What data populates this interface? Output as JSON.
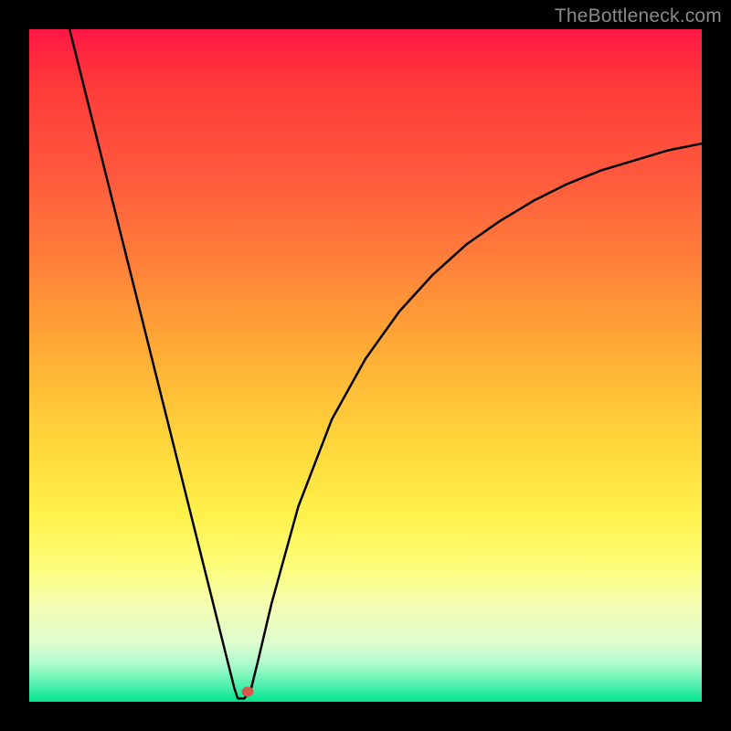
{
  "watermark": "TheBottleneck.com",
  "marker": {
    "x_frac": 0.325,
    "y_frac": 0.985
  },
  "colors": {
    "top": "#ff1744",
    "bottom": "#00e58c",
    "frame": "#000000",
    "curve": "#000000",
    "marker": "#d6574c",
    "watermark": "#8a8a8a"
  },
  "chart_data": {
    "type": "line",
    "title": "",
    "xlabel": "",
    "ylabel": "",
    "xlim": [
      0,
      1
    ],
    "ylim": [
      0,
      1
    ],
    "background_gradient": {
      "direction": "vertical",
      "stops": [
        {
          "pos": 0.0,
          "color": "#ff1744"
        },
        {
          "pos": 0.22,
          "color": "#ff5a3d"
        },
        {
          "pos": 0.46,
          "color": "#ffa636"
        },
        {
          "pos": 0.72,
          "color": "#fff14a"
        },
        {
          "pos": 0.91,
          "color": "#e0fccc"
        },
        {
          "pos": 1.0,
          "color": "#00e58c"
        }
      ]
    },
    "note": "V-shaped bottleneck curve; minimum near x≈0.31, y≈0 (optimal / no bottleneck). Values rise steeply to left and more gradually (concave) to right, both approaching y≈1 at edges.",
    "series": [
      {
        "name": "bottleneck-curve",
        "x": [
          0.06,
          0.09,
          0.12,
          0.15,
          0.18,
          0.21,
          0.24,
          0.27,
          0.29,
          0.3,
          0.305,
          0.31,
          0.32,
          0.33,
          0.34,
          0.36,
          0.4,
          0.45,
          0.5,
          0.55,
          0.6,
          0.65,
          0.7,
          0.75,
          0.8,
          0.85,
          0.9,
          0.95,
          1.0
        ],
        "y": [
          1.0,
          0.88,
          0.76,
          0.64,
          0.52,
          0.4,
          0.28,
          0.16,
          0.08,
          0.04,
          0.02,
          0.005,
          0.005,
          0.02,
          0.06,
          0.145,
          0.29,
          0.42,
          0.51,
          0.58,
          0.635,
          0.68,
          0.715,
          0.745,
          0.77,
          0.79,
          0.805,
          0.82,
          0.83
        ]
      }
    ],
    "marker_points": [
      {
        "name": "optimal-point",
        "x": 0.325,
        "y": 0.015
      }
    ]
  }
}
